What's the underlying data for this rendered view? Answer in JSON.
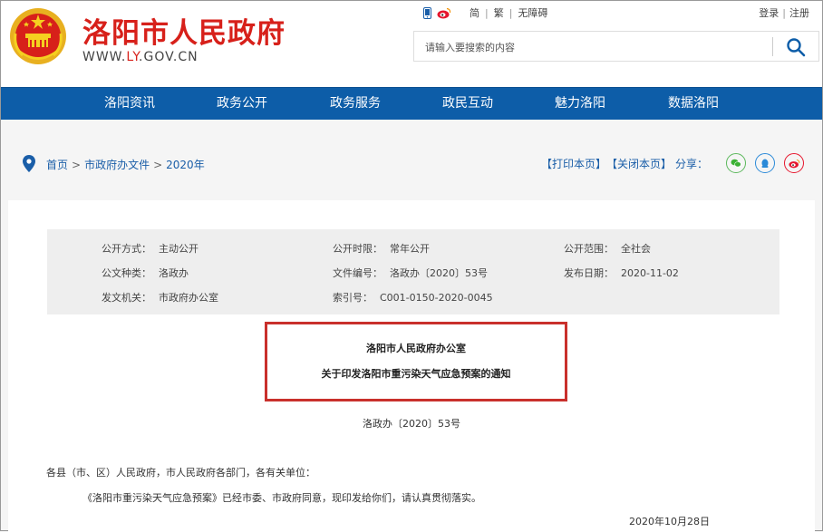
{
  "header": {
    "site_title": "洛阳市人民政府",
    "url_prefix": "WWW.",
    "url_highlight": "LY",
    "url_suffix": ".GOV.CN",
    "toplinks": {
      "simplified": "简",
      "traditional": "繁",
      "accessibility": "无障碍"
    },
    "auth": {
      "login": "登录",
      "register": "注册"
    },
    "search_placeholder": "请输入要搜索的内容"
  },
  "nav": {
    "items": [
      {
        "label": "洛阳资讯"
      },
      {
        "label": "政务公开"
      },
      {
        "label": "政务服务"
      },
      {
        "label": "政民互动"
      },
      {
        "label": "魅力洛阳"
      },
      {
        "label": "数据洛阳"
      }
    ]
  },
  "breadcrumb": {
    "items": [
      {
        "label": "首页"
      },
      {
        "label": "市政府办文件"
      },
      {
        "label": "2020年"
      }
    ]
  },
  "tools": {
    "print": "【打印本页】",
    "close": "【关闭本页】",
    "share_label": "分享："
  },
  "meta": {
    "rows": [
      [
        {
          "label": "公开方式：",
          "value": "主动公开"
        },
        {
          "label": "公开时限：",
          "value": "常年公开"
        },
        {
          "label": "公开范围：",
          "value": "全社会"
        }
      ],
      [
        {
          "label": "公文种类：",
          "value": "洛政办"
        },
        {
          "label": "文件编号：",
          "value": "洛政办〔2020〕53号"
        },
        {
          "label": "发布日期：",
          "value": "2020-11-02"
        }
      ],
      [
        {
          "label": "发文机关：",
          "value": "市政府办公室"
        },
        {
          "label": "索引号：",
          "value": "C001-0150-2020-0045"
        }
      ]
    ]
  },
  "document": {
    "issuer": "洛阳市人民政府办公室",
    "title": "关于印发洛阳市重污染天气应急预案的通知",
    "number": "洛政办〔2020〕53号",
    "salutation": "各县（市、区）人民政府，市人民政府各部门，各有关单位：",
    "body": "《洛阳市重污染天气应急预案》已经市委、市政府同意，现印发给你们，请认真贯彻落实。",
    "date": "2020年10月28日"
  },
  "colors": {
    "brand_red": "#d7201a",
    "nav_blue": "#0d5da8",
    "link_blue": "#1a5ea8",
    "highlight_border": "#c9302c"
  }
}
